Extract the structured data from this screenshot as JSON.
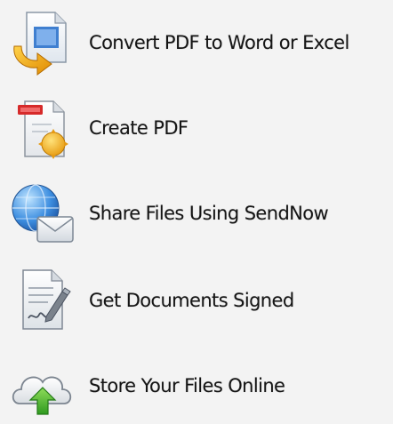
{
  "menu": {
    "items": [
      {
        "label": "Convert PDF to Word or Excel",
        "icon": "convert-pdf-icon"
      },
      {
        "label": "Create PDF",
        "icon": "create-pdf-icon"
      },
      {
        "label": "Share Files Using SendNow",
        "icon": "share-globe-mail-icon"
      },
      {
        "label": "Get Documents Signed",
        "icon": "sign-document-icon"
      },
      {
        "label": "Store Your Files Online",
        "icon": "cloud-upload-icon"
      }
    ]
  }
}
